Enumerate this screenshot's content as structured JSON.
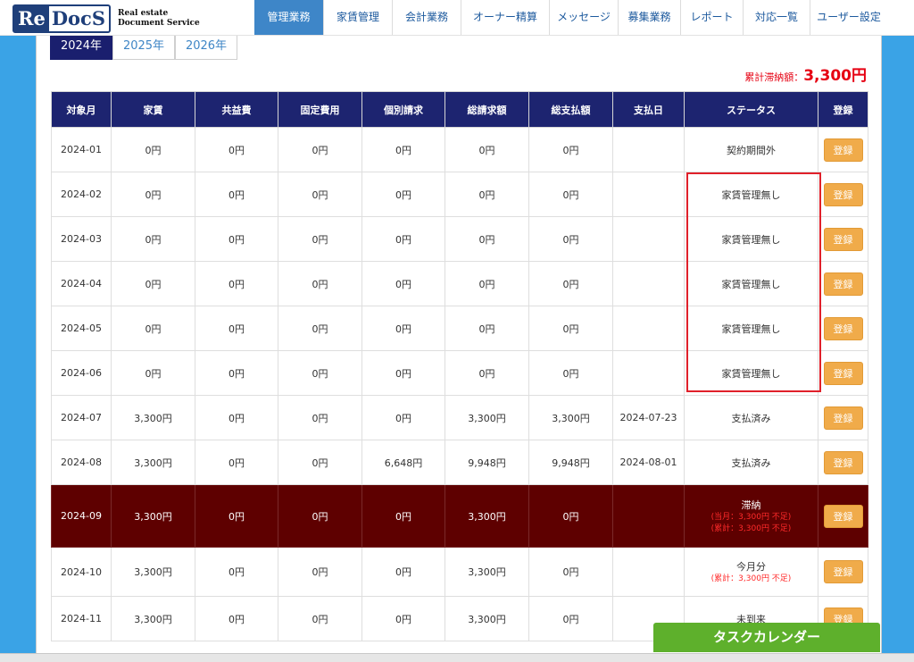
{
  "logo": {
    "re": "Re",
    "docs": "DocS",
    "line1": "Real estate",
    "line2": "Document Service"
  },
  "nav": [
    {
      "label": "管理業務",
      "active": true
    },
    {
      "label": "家賃管理"
    },
    {
      "label": "会計業務"
    },
    {
      "label": "オーナー精算"
    },
    {
      "label": "メッセージ"
    },
    {
      "label": "募集業務"
    },
    {
      "label": "レポート"
    },
    {
      "label": "対応一覧"
    },
    {
      "label": "ユーザー設定"
    }
  ],
  "years": [
    {
      "label": "2024年",
      "active": true
    },
    {
      "label": "2025年"
    },
    {
      "label": "2026年"
    }
  ],
  "total": {
    "label": "累計滞納額：",
    "value": "3,300円"
  },
  "table": {
    "headers": [
      "対象月",
      "家賃",
      "共益費",
      "固定費用",
      "個別請求",
      "総請求額",
      "総支払額",
      "支払日",
      "ステータス",
      "登録"
    ],
    "register_label": "登録",
    "rows": [
      {
        "month": "2024-01",
        "rent": "0円",
        "common": "0円",
        "fixed": "0円",
        "individual": "0円",
        "total_bill": "0円",
        "total_paid": "0円",
        "pay_date": "",
        "status": "契約期間外",
        "notes": []
      },
      {
        "month": "2024-02",
        "rent": "0円",
        "common": "0円",
        "fixed": "0円",
        "individual": "0円",
        "total_bill": "0円",
        "total_paid": "0円",
        "pay_date": "",
        "status": "家賃管理無し",
        "notes": []
      },
      {
        "month": "2024-03",
        "rent": "0円",
        "common": "0円",
        "fixed": "0円",
        "individual": "0円",
        "total_bill": "0円",
        "total_paid": "0円",
        "pay_date": "",
        "status": "家賃管理無し",
        "notes": []
      },
      {
        "month": "2024-04",
        "rent": "0円",
        "common": "0円",
        "fixed": "0円",
        "individual": "0円",
        "total_bill": "0円",
        "total_paid": "0円",
        "pay_date": "",
        "status": "家賃管理無し",
        "notes": []
      },
      {
        "month": "2024-05",
        "rent": "0円",
        "common": "0円",
        "fixed": "0円",
        "individual": "0円",
        "total_bill": "0円",
        "total_paid": "0円",
        "pay_date": "",
        "status": "家賃管理無し",
        "notes": []
      },
      {
        "month": "2024-06",
        "rent": "0円",
        "common": "0円",
        "fixed": "0円",
        "individual": "0円",
        "total_bill": "0円",
        "total_paid": "0円",
        "pay_date": "",
        "status": "家賃管理無し",
        "notes": []
      },
      {
        "month": "2024-07",
        "rent": "3,300円",
        "common": "0円",
        "fixed": "0円",
        "individual": "0円",
        "total_bill": "3,300円",
        "total_paid": "3,300円",
        "pay_date": "2024-07-23",
        "status": "支払済み",
        "notes": []
      },
      {
        "month": "2024-08",
        "rent": "3,300円",
        "common": "0円",
        "fixed": "0円",
        "individual": "6,648円",
        "total_bill": "9,948円",
        "total_paid": "9,948円",
        "pay_date": "2024-08-01",
        "status": "支払済み",
        "notes": []
      },
      {
        "month": "2024-09",
        "rent": "3,300円",
        "common": "0円",
        "fixed": "0円",
        "individual": "0円",
        "total_bill": "3,300円",
        "total_paid": "0円",
        "pay_date": "",
        "status": "滞納",
        "notes": [
          "(当月：3,300円 不足)",
          "(累計：3,300円 不足)"
        ],
        "overdue": true
      },
      {
        "month": "2024-10",
        "rent": "3,300円",
        "common": "0円",
        "fixed": "0円",
        "individual": "0円",
        "total_bill": "3,300円",
        "total_paid": "0円",
        "pay_date": "",
        "status": "今月分",
        "notes": [
          "(累計：3,300円 不足)"
        ],
        "current": true
      },
      {
        "month": "2024-11",
        "rent": "3,300円",
        "common": "0円",
        "fixed": "0円",
        "individual": "0円",
        "total_bill": "3,300円",
        "total_paid": "0円",
        "pay_date": "",
        "status": "未到来",
        "notes": []
      }
    ]
  },
  "task_calendar": "タスクカレンダー",
  "colors": {
    "navy": "#1d2470",
    "overdue": "#5e0000",
    "orange": "#f0ab4a",
    "red": "#e60012",
    "green": "#5eb02c",
    "blue": "#3aa3e6"
  }
}
